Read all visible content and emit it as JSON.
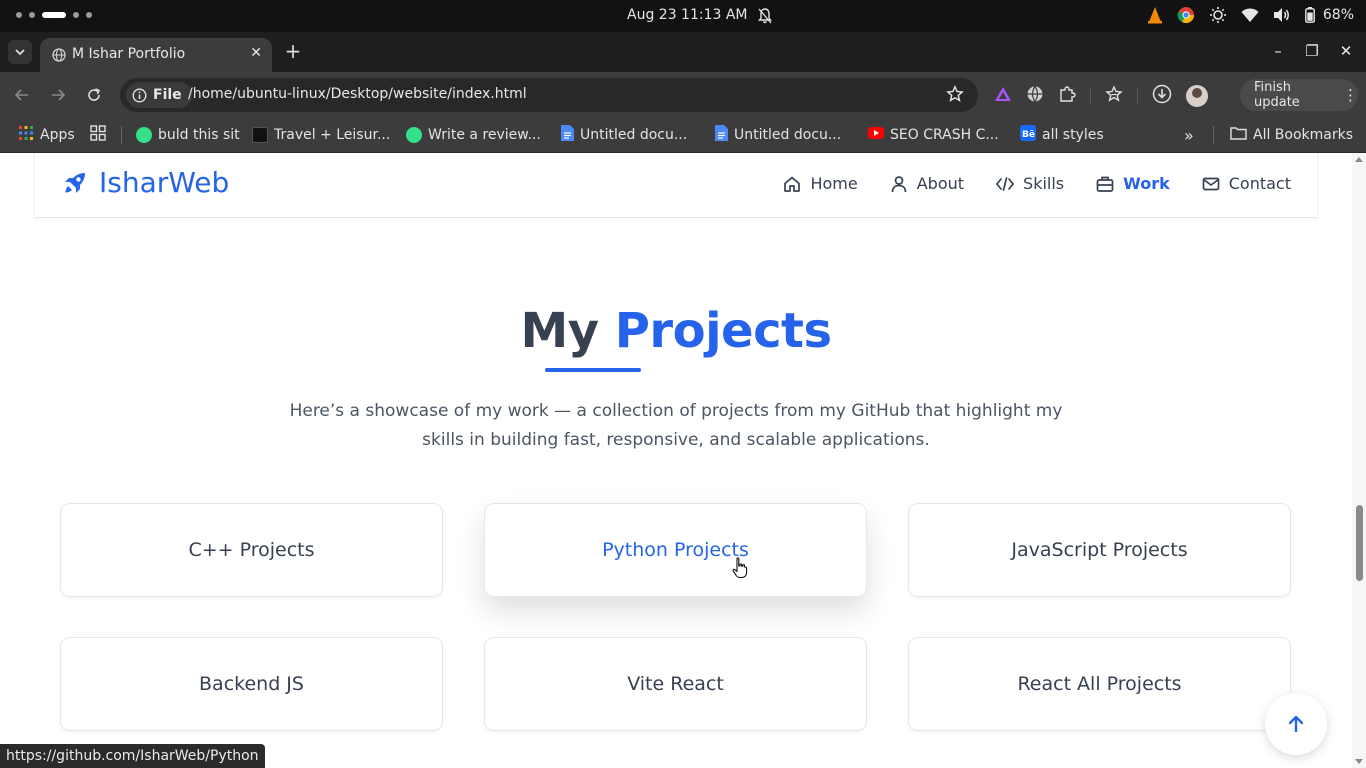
{
  "system": {
    "clock": "Aug 23  11:13 AM",
    "battery": "68%"
  },
  "browser": {
    "tab_title": "M Ishar Portfolio",
    "url_chip": "File",
    "url": "/home/ubuntu-linux/Desktop/website/index.html",
    "finish_update": "Finish update",
    "status_url": "https://github.com/IsharWeb/Python"
  },
  "bookmarks": {
    "items": [
      {
        "label": "Apps",
        "color": "#4285f4"
      },
      {
        "label": "buld this sit",
        "color": "#34e08a"
      },
      {
        "label": "Travel + Leisur...",
        "color": "#111111"
      },
      {
        "label": "Write a review...",
        "color": "#34e08a"
      },
      {
        "label": "Untitled docu...",
        "color": "#4a8af4"
      },
      {
        "label": "Untitled docu...",
        "color": "#4a8af4"
      },
      {
        "label": "SEO CRASH C...",
        "color": "#ff0000"
      },
      {
        "label": "all styles",
        "color": "#1769ff"
      }
    ],
    "all_bookmarks": "All Bookmarks"
  },
  "site": {
    "brand": "IsharWeb",
    "accent_color": "#2563eb",
    "nav": [
      {
        "label": "Home",
        "icon": "home-icon"
      },
      {
        "label": "About",
        "icon": "user-icon"
      },
      {
        "label": "Skills",
        "icon": "code-icon"
      },
      {
        "label": "Work",
        "icon": "briefcase-icon",
        "active": true
      },
      {
        "label": "Contact",
        "icon": "mail-icon"
      }
    ]
  },
  "projects": {
    "heading_plain": "My",
    "heading_accent": "Projects",
    "intro": "Here’s a showcase of my work — a collection of projects from my GitHub that highlight my skills in building fast, responsive, and scalable applications.",
    "cards": [
      "C++ Projects",
      "Python Projects",
      "JavaScript Projects",
      "Backend JS",
      "Vite React",
      "React All Projects"
    ],
    "hovered_card": "Python Projects"
  }
}
